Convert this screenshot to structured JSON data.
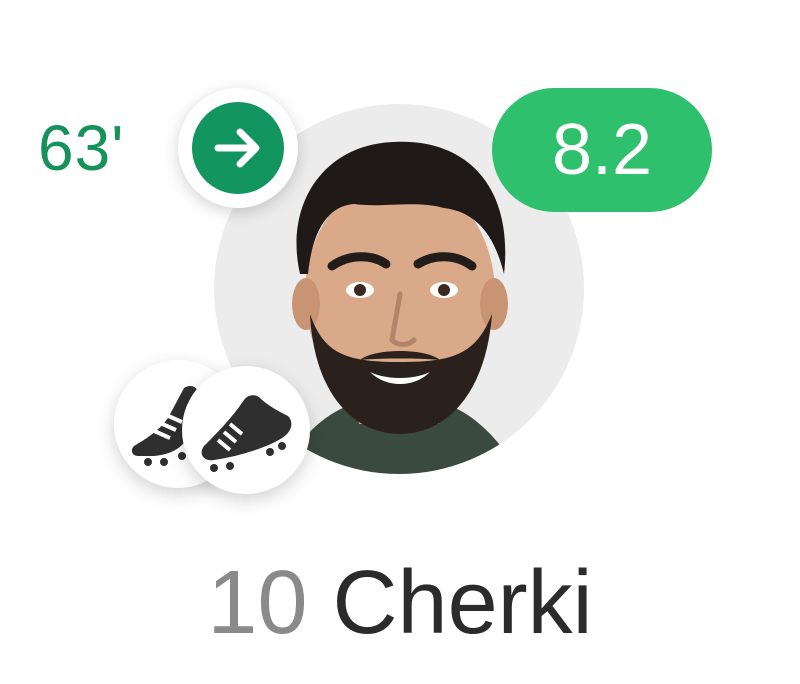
{
  "player": {
    "shirt_number": "10",
    "name": "Cherki",
    "rating": "8.2",
    "sub_minute": "63'"
  },
  "icons": {
    "substitution": "arrow-right-icon",
    "assist_boot": "football-boot-icon",
    "photo": "player-photo"
  },
  "colors": {
    "sub_green": "#17915a",
    "rating_green": "#2fc06e",
    "name": "#2b2b2b",
    "number": "#8a8a8a",
    "photo_bg": "#ececec"
  }
}
